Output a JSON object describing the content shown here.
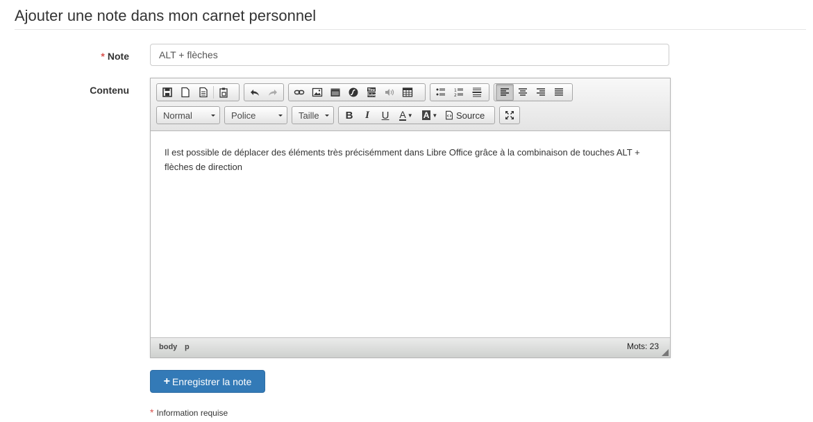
{
  "page": {
    "title": "Ajouter une note dans mon carnet personnel"
  },
  "form": {
    "note_required_mark": "*",
    "note_label": "Note",
    "note_value": "ALT + flèches",
    "content_label": "Contenu",
    "save_label": "Enregistrer la note",
    "save_icon": "+",
    "required_mark": "*",
    "required_info": "Information requise"
  },
  "editor": {
    "toolbar_row1_icons": [
      "save-icon",
      "new-page-icon",
      "templates-icon",
      "paste-from-word-icon",
      "undo-icon",
      "redo-icon",
      "link-icon",
      "image-icon",
      "video-icon",
      "flash-icon",
      "youtube-icon",
      "audio-icon",
      "table-icon",
      "bulleted-list-icon",
      "numbered-list-icon",
      "horizontal-line-icon",
      "align-left-icon",
      "align-center-icon",
      "align-right-icon",
      "justify-icon"
    ],
    "format_value": "Normal",
    "font_value": "Police",
    "size_value": "Taille",
    "bold_label": "B",
    "italic_label": "I",
    "underline_label": "U",
    "text_color_label": "A",
    "bg_color_label": "A",
    "source_label": "Source",
    "content_text": "Il est possible de déplacer des éléments très précisémment dans Libre Office grâce à la combinaison de touches ALT + flèches de direction",
    "path_body": "body",
    "path_p": "p",
    "word_count": "Mots: 23"
  },
  "colors": {
    "primary": "#337ab7",
    "required": "#d9534f"
  }
}
